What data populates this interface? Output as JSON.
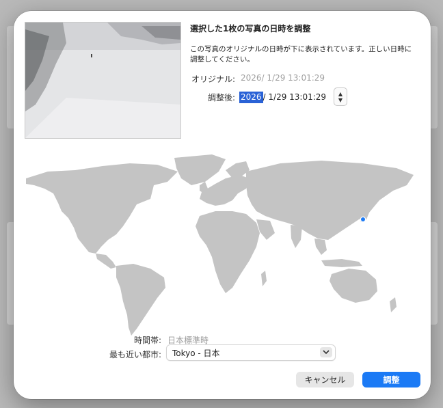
{
  "dialog": {
    "title": "選択した1枚の写真の日時を調整",
    "description": "この写真のオリジナルの日時が下に表示されています。正しい日時に調整してください。",
    "original_label": "オリジナル:",
    "original_value": "2026/ 1/29 13:01:29",
    "adjusted_label": "調整後:",
    "adjusted_year": "2026",
    "adjusted_rest": "/ 1/29 13:01:29",
    "timezone_label": "時間帯:",
    "timezone_value": "日本標準時",
    "city_label": "最も近い都市:",
    "city_value": "Tokyo - 日本",
    "cancel_label": "キャンセル",
    "ok_label": "調整"
  },
  "colors": {
    "accent": "#1b7af5",
    "selection": "#2a62d6",
    "map_land": "#c4c4c4",
    "location_pin": "#1b7af5"
  },
  "icons": {
    "stepper": "stepper-arrows-icon",
    "dropdown": "chevron-down-icon",
    "pin": "location-pin-icon"
  }
}
